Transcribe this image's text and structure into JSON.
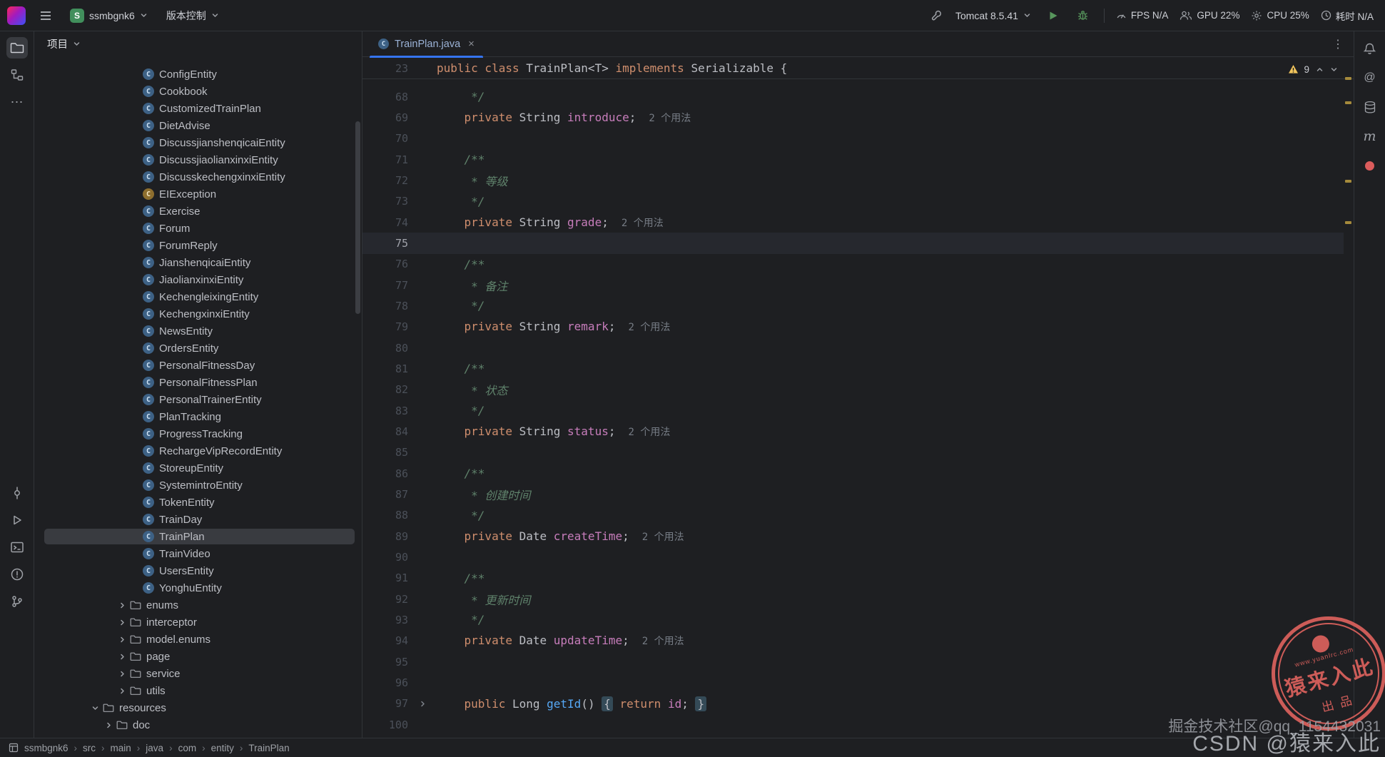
{
  "titlebar": {
    "project_name": "ssmbgnk6",
    "project_badge": "S",
    "vcs_label": "版本控制",
    "run_config": "Tomcat 8.5.41",
    "metrics": {
      "fps": "FPS N/A",
      "gpu": "GPU 22%",
      "cpu": "CPU 25%",
      "elapsed": "耗时 N/A"
    }
  },
  "glyphs": {
    "kebab": "⋮",
    "more": "⋯",
    "at": "@",
    "maven": "m"
  },
  "icon_names": [
    "intellij-logo",
    "hamburger-menu",
    "project-badge",
    "chevron-down",
    "chevron-up",
    "chevron-right",
    "wrench",
    "run-play",
    "debug-bug",
    "gauge",
    "users",
    "gear",
    "clock",
    "project-folder",
    "structure",
    "more-tools",
    "commit",
    "run",
    "terminal",
    "problems",
    "git-branch",
    "bell",
    "mentions-at",
    "database",
    "maven-m",
    "plugin-dot",
    "class",
    "exception",
    "folder",
    "warning",
    "fold-chevron",
    "close",
    "kebab",
    "module"
  ],
  "project_panel": {
    "header_label": "项目",
    "class_letter": "C",
    "tree": [
      {
        "label": "ConfigEntity",
        "kind": "class",
        "depth": 7
      },
      {
        "label": "Cookbook",
        "kind": "class",
        "depth": 7
      },
      {
        "label": "CustomizedTrainPlan",
        "kind": "class",
        "depth": 7
      },
      {
        "label": "DietAdvise",
        "kind": "class",
        "depth": 7
      },
      {
        "label": "DiscussjianshenqicaiEntity",
        "kind": "class",
        "depth": 7
      },
      {
        "label": "DiscussjiaolianxinxiEntity",
        "kind": "class",
        "depth": 7
      },
      {
        "label": "DiscusskechengxinxiEntity",
        "kind": "class",
        "depth": 7
      },
      {
        "label": "EIException",
        "kind": "exception",
        "depth": 7
      },
      {
        "label": "Exercise",
        "kind": "class",
        "depth": 7
      },
      {
        "label": "Forum",
        "kind": "class",
        "depth": 7
      },
      {
        "label": "ForumReply",
        "kind": "class",
        "depth": 7
      },
      {
        "label": "JianshenqicaiEntity",
        "kind": "class",
        "depth": 7
      },
      {
        "label": "JiaolianxinxiEntity",
        "kind": "class",
        "depth": 7
      },
      {
        "label": "KechengleixingEntity",
        "kind": "class",
        "depth": 7
      },
      {
        "label": "KechengxinxiEntity",
        "kind": "class",
        "depth": 7
      },
      {
        "label": "NewsEntity",
        "kind": "class",
        "depth": 7
      },
      {
        "label": "OrdersEntity",
        "kind": "class",
        "depth": 7
      },
      {
        "label": "PersonalFitnessDay",
        "kind": "class",
        "depth": 7
      },
      {
        "label": "PersonalFitnessPlan",
        "kind": "class",
        "depth": 7
      },
      {
        "label": "PersonalTrainerEntity",
        "kind": "class",
        "depth": 7
      },
      {
        "label": "PlanTracking",
        "kind": "class",
        "depth": 7
      },
      {
        "label": "ProgressTracking",
        "kind": "class",
        "depth": 7
      },
      {
        "label": "RechargeVipRecordEntity",
        "kind": "class",
        "depth": 7
      },
      {
        "label": "StoreupEntity",
        "kind": "class",
        "depth": 7
      },
      {
        "label": "SystemintroEntity",
        "kind": "class",
        "depth": 7
      },
      {
        "label": "TokenEntity",
        "kind": "class",
        "depth": 7
      },
      {
        "label": "TrainDay",
        "kind": "class",
        "depth": 7
      },
      {
        "label": "TrainPlan",
        "kind": "class",
        "depth": 7,
        "selected": true
      },
      {
        "label": "TrainVideo",
        "kind": "class",
        "depth": 7
      },
      {
        "label": "UsersEntity",
        "kind": "class",
        "depth": 7
      },
      {
        "label": "YonghuEntity",
        "kind": "class",
        "depth": 7
      },
      {
        "label": "enums",
        "kind": "folder",
        "depth": 6,
        "chevron": "collapsed"
      },
      {
        "label": "interceptor",
        "kind": "folder",
        "depth": 6,
        "chevron": "collapsed"
      },
      {
        "label": "model.enums",
        "kind": "folder",
        "depth": 6,
        "chevron": "collapsed"
      },
      {
        "label": "page",
        "kind": "folder",
        "depth": 6,
        "chevron": "collapsed"
      },
      {
        "label": "service",
        "kind": "folder",
        "depth": 6,
        "chevron": "collapsed"
      },
      {
        "label": "utils",
        "kind": "folder",
        "depth": 6,
        "chevron": "collapsed"
      },
      {
        "label": "resources",
        "kind": "folder",
        "depth": 4,
        "chevron": "expanded"
      },
      {
        "label": "doc",
        "kind": "folder",
        "depth": 5,
        "chevron": "collapsed"
      }
    ]
  },
  "editor": {
    "tab": {
      "label": "TrainPlan.java",
      "icon_letter": "C",
      "close": "×"
    },
    "inspections": {
      "warning_count": "9"
    },
    "sticky_line": {
      "num": "23",
      "tokens": [
        [
          "k",
          "public class "
        ],
        [
          "p",
          "TrainPlan<T> "
        ],
        [
          "k",
          "implements "
        ],
        [
          "p",
          "Serializable {"
        ]
      ]
    },
    "lines": [
      {
        "n": "68",
        "t": [
          [
            "c",
            "     */"
          ]
        ]
      },
      {
        "n": "69",
        "t": [
          [
            "k",
            "    private "
          ],
          [
            "p",
            "String "
          ],
          [
            "f",
            "introduce"
          ],
          [
            "p",
            ";"
          ],
          [
            "h",
            "2 个用法"
          ]
        ]
      },
      {
        "n": "70",
        "t": []
      },
      {
        "n": "71",
        "t": [
          [
            "c",
            "    /**"
          ]
        ]
      },
      {
        "n": "72",
        "t": [
          [
            "c",
            "     * 等级"
          ]
        ]
      },
      {
        "n": "73",
        "t": [
          [
            "c",
            "     */"
          ]
        ]
      },
      {
        "n": "74",
        "t": [
          [
            "k",
            "    private "
          ],
          [
            "p",
            "String "
          ],
          [
            "f",
            "grade"
          ],
          [
            "p",
            ";"
          ],
          [
            "h",
            "2 个用法"
          ]
        ]
      },
      {
        "n": "75",
        "cur": true,
        "t": []
      },
      {
        "n": "76",
        "t": [
          [
            "c",
            "    /**"
          ]
        ]
      },
      {
        "n": "77",
        "t": [
          [
            "c",
            "     * 备注"
          ]
        ]
      },
      {
        "n": "78",
        "t": [
          [
            "c",
            "     */"
          ]
        ]
      },
      {
        "n": "79",
        "t": [
          [
            "k",
            "    private "
          ],
          [
            "p",
            "String "
          ],
          [
            "f",
            "remark"
          ],
          [
            "p",
            ";"
          ],
          [
            "h",
            "2 个用法"
          ]
        ]
      },
      {
        "n": "80",
        "t": []
      },
      {
        "n": "81",
        "t": [
          [
            "c",
            "    /**"
          ]
        ]
      },
      {
        "n": "82",
        "t": [
          [
            "c",
            "     * 状态"
          ]
        ]
      },
      {
        "n": "83",
        "t": [
          [
            "c",
            "     */"
          ]
        ]
      },
      {
        "n": "84",
        "t": [
          [
            "k",
            "    private "
          ],
          [
            "p",
            "String "
          ],
          [
            "f",
            "status"
          ],
          [
            "p",
            ";"
          ],
          [
            "h",
            "2 个用法"
          ]
        ]
      },
      {
        "n": "85",
        "t": []
      },
      {
        "n": "86",
        "t": [
          [
            "c",
            "    /**"
          ]
        ]
      },
      {
        "n": "87",
        "t": [
          [
            "c",
            "     * 创建时间"
          ]
        ]
      },
      {
        "n": "88",
        "t": [
          [
            "c",
            "     */"
          ]
        ]
      },
      {
        "n": "89",
        "t": [
          [
            "k",
            "    private "
          ],
          [
            "p",
            "Date "
          ],
          [
            "f",
            "createTime"
          ],
          [
            "p",
            ";"
          ],
          [
            "h",
            "2 个用法"
          ]
        ]
      },
      {
        "n": "90",
        "t": []
      },
      {
        "n": "91",
        "t": [
          [
            "c",
            "    /**"
          ]
        ]
      },
      {
        "n": "92",
        "t": [
          [
            "c",
            "     * 更新时间"
          ]
        ]
      },
      {
        "n": "93",
        "t": [
          [
            "c",
            "     */"
          ]
        ]
      },
      {
        "n": "94",
        "t": [
          [
            "k",
            "    private "
          ],
          [
            "p",
            "Date "
          ],
          [
            "f",
            "updateTime"
          ],
          [
            "p",
            ";"
          ],
          [
            "h",
            "2 个用法"
          ]
        ]
      },
      {
        "n": "95",
        "t": []
      },
      {
        "n": "96",
        "t": []
      },
      {
        "n": "97",
        "fold": true,
        "t": [
          [
            "k",
            "    public "
          ],
          [
            "p",
            "Long "
          ],
          [
            "m",
            "getId"
          ],
          [
            "p",
            "() "
          ],
          [
            "b",
            "{"
          ],
          [
            "p",
            " "
          ],
          [
            "k",
            "return"
          ],
          [
            "p",
            " "
          ],
          [
            "f",
            "id"
          ],
          [
            "p",
            "; "
          ],
          [
            "b",
            "}"
          ]
        ]
      },
      {
        "n": "100",
        "t": []
      }
    ]
  },
  "breadcrumbs": {
    "items": [
      "ssmbgnk6",
      "src",
      "main",
      "java",
      "com",
      "entity",
      "TrainPlan"
    ]
  },
  "watermark": {
    "stamp_title": "猿来入此",
    "stamp_sub": "出品",
    "stamp_url": "www.yuanlrc.com",
    "overlay_line1": "掘金技术社区@qq_1154432031",
    "overlay_line2": "CSDN @猿来入此"
  },
  "colors": {
    "accent_blue": "#3574F0",
    "keyword": "#CF8E6D",
    "field": "#C77DBB",
    "method": "#56A8F5",
    "doc_comment": "#5F826B",
    "warning": "#F2C55C",
    "run_green": "#57965C",
    "stamp_red": "#D8605C"
  }
}
